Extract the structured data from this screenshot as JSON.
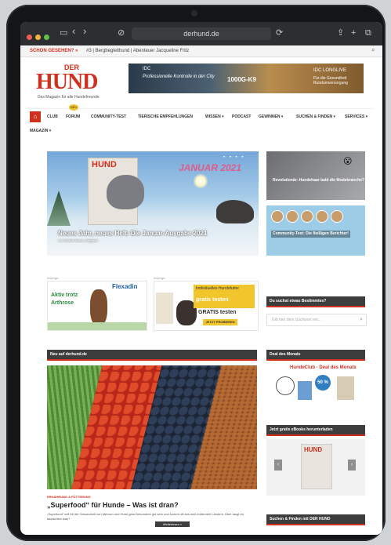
{
  "browser": {
    "url": "derhund.de",
    "back": "‹",
    "forward": "›",
    "sidebar_icon": "▭",
    "reload": "⟳",
    "share": "⇪",
    "plus": "+",
    "tabs": "⧉",
    "download": "⊘"
  },
  "topbar": {
    "hot_label": "SCHON GESEHEN? »",
    "ticker": "#3 | Bergbegleithund | Abenteuer Jacqueline Fritz",
    "search_icon": "⌕"
  },
  "header": {
    "logo_der": "DER",
    "logo_hund": "HUND",
    "logo_tagline": "Das Magazin für alle Hundefreunde"
  },
  "banner": {
    "brand_left": "IDC",
    "line1": "Professionelle",
    "line2": "Kontrolle in der City",
    "product": "1000G-K9",
    "brand_right": "IDC LONGLIVE",
    "line3": "Für die Gesundheit",
    "line4": "Rundumversorgung"
  },
  "nav": {
    "home_icon": "⌂",
    "badge": "NEU",
    "items": [
      "Club",
      "Forum",
      "Community-Test",
      "Tierische Empfehlungen",
      "Wissen ▾",
      "Podcast",
      "Gewinnen ▾",
      "Suchen & Finden ▾",
      "Services ▾",
      "Magazin ▾"
    ]
  },
  "hero": {
    "mag_logo": "HUND",
    "jan_text": "JANUAR 2021",
    "slider_dots": "• • • •",
    "caption": "Neues Jahr, neues Heft: Die Januar-Ausgabe 2021",
    "caption_sub": "von Gudrun Braun  |  Magazin"
  },
  "side_teasers": [
    {
      "title": "Revolutionär: Hundehaar bald die Modebranche?",
      "emoji": "😮"
    },
    {
      "title": "Community-Test: Die fleißigen Berichter!"
    }
  ],
  "ads": {
    "label": "Anzeige",
    "ad1_line1": "Aktiv trotz",
    "ad1_line2": "Arthrose",
    "ad1_brand": "Flexadin",
    "ad2_text_a": "Individuelles Hundefutter",
    "ad2_text_b": "gratis testen",
    "ad2_text_c": "GRATIS testen",
    "ad2_btn": "JETZT PROBIEREN"
  },
  "sidebar": {
    "search_head": "Du suchst etwas Bestimmtes?",
    "search_placeholder": "Gib hier dein Suchwort ein...",
    "search_icon": "⌕",
    "deal_head": "Deal des Monats",
    "deal_brand": "HundeClub · Deal des Monats",
    "deal_pct": "50 %",
    "ebooks_head": "Jetzt gratis eBooks herunterladen",
    "ebook_cover": "HUND",
    "arrow_left": "‹",
    "arrow_right": "›",
    "search_find_head": "Suchen & Finden mit DER HUND"
  },
  "news": {
    "head": "Neu auf derhund.de",
    "article_category": "ERNÄHRUNG & FÜTTERUNG",
    "article_title": "„Superfood“ für Hunde – Was ist dran?",
    "article_excerpt": "„Superfood“ soll für die Gesundheit von Mensch und Hund ganz besonders gut sein und kommt oft aus weit entfernten Ländern. Aber taugt es tatsächlich was?",
    "read_more": "Weiterlesen »"
  },
  "colors": {
    "brand_red": "#d0311f",
    "dark_bar": "#3d3d3d",
    "accent_yellow": "#f3c52c"
  }
}
